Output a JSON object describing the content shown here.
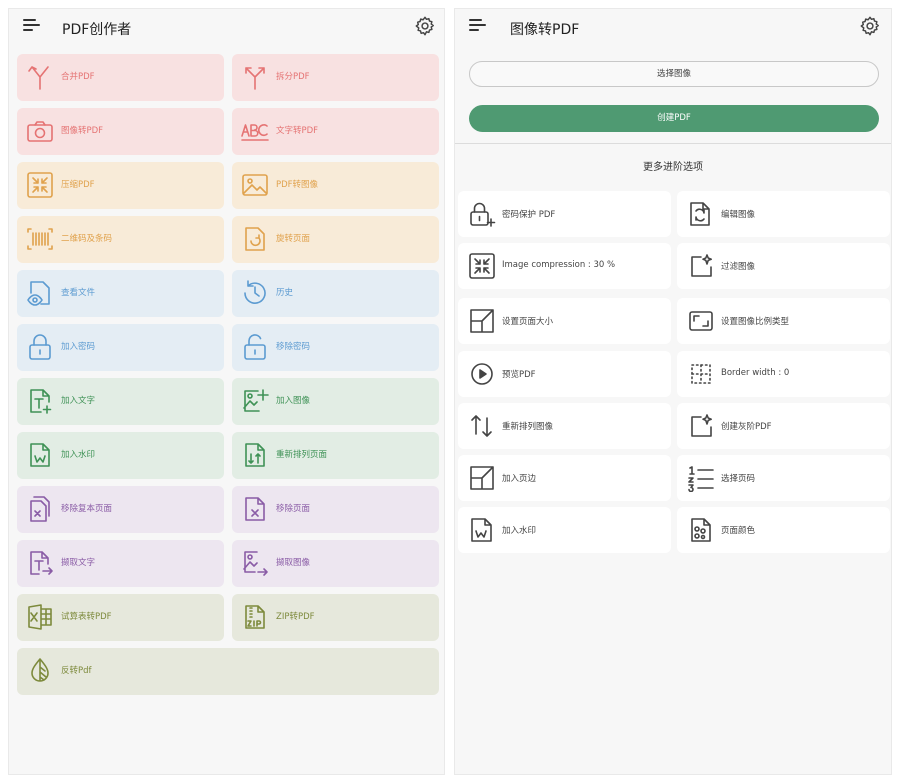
{
  "home": {
    "title": "PDF创作者",
    "tiles": [
      {
        "label": "合并PDF",
        "icon": "merge-icon"
      },
      {
        "label": "拆分PDF",
        "icon": "split-icon"
      },
      {
        "label": "图像转PDF",
        "icon": "camera-icon"
      },
      {
        "label": "文字转PDF",
        "icon": "text-abc-icon"
      },
      {
        "label": "压缩PDF",
        "icon": "compress-icon"
      },
      {
        "label": "PDF转图像",
        "icon": "image-icon"
      },
      {
        "label": "二维码及条码",
        "icon": "barcode-icon"
      },
      {
        "label": "旋转页面",
        "icon": "rotate-page-icon"
      },
      {
        "label": "查看文件",
        "icon": "view-file-icon"
      },
      {
        "label": "历史",
        "icon": "history-icon"
      },
      {
        "label": "加入密码",
        "icon": "lock-icon"
      },
      {
        "label": "移除密码",
        "icon": "unlock-icon"
      },
      {
        "label": "加入文字",
        "icon": "add-text-icon"
      },
      {
        "label": "加入图像",
        "icon": "add-image-icon"
      },
      {
        "label": "加入水印",
        "icon": "watermark-icon"
      },
      {
        "label": "重新排列页面",
        "icon": "reorder-pages-icon"
      },
      {
        "label": "移除复本页面",
        "icon": "remove-duplicate-icon"
      },
      {
        "label": "移除页面",
        "icon": "remove-page-icon"
      },
      {
        "label": "撷取文字",
        "icon": "extract-text-icon"
      },
      {
        "label": "撷取图像",
        "icon": "extract-image-icon"
      },
      {
        "label": "试算表转PDF",
        "icon": "excel-icon"
      },
      {
        "label": "ZIP转PDF",
        "icon": "zip-icon"
      },
      {
        "label": "反转Pdf",
        "icon": "invert-icon"
      }
    ]
  },
  "img2pdf": {
    "title": "图像转PDF",
    "select_label": "选择图像",
    "create_label": "创建PDF",
    "advanced_title": "更多进阶选项",
    "options": [
      {
        "label": "密码保护 PDF",
        "icon": "lock-plus-icon"
      },
      {
        "label": "编辑图像",
        "icon": "edit-image-icon"
      },
      {
        "label": "Image compression : 30 %",
        "icon": "compress-icon"
      },
      {
        "label": "过滤图像",
        "icon": "filter-icon"
      },
      {
        "label": "设置页面大小",
        "icon": "page-size-icon"
      },
      {
        "label": "设置图像比例类型",
        "icon": "scale-type-icon"
      },
      {
        "label": "预览PDF",
        "icon": "play-icon"
      },
      {
        "label": "Border width : 0",
        "icon": "border-icon"
      },
      {
        "label": "重新排列图像",
        "icon": "rearrange-icon"
      },
      {
        "label": "创建灰阶PDF",
        "icon": "grayscale-icon"
      },
      {
        "label": "加入页边",
        "icon": "margin-icon"
      },
      {
        "label": "选择页码",
        "icon": "page-number-icon"
      },
      {
        "label": "加入水印",
        "icon": "watermark-icon"
      },
      {
        "label": "页面颜色",
        "icon": "page-color-icon"
      }
    ]
  }
}
